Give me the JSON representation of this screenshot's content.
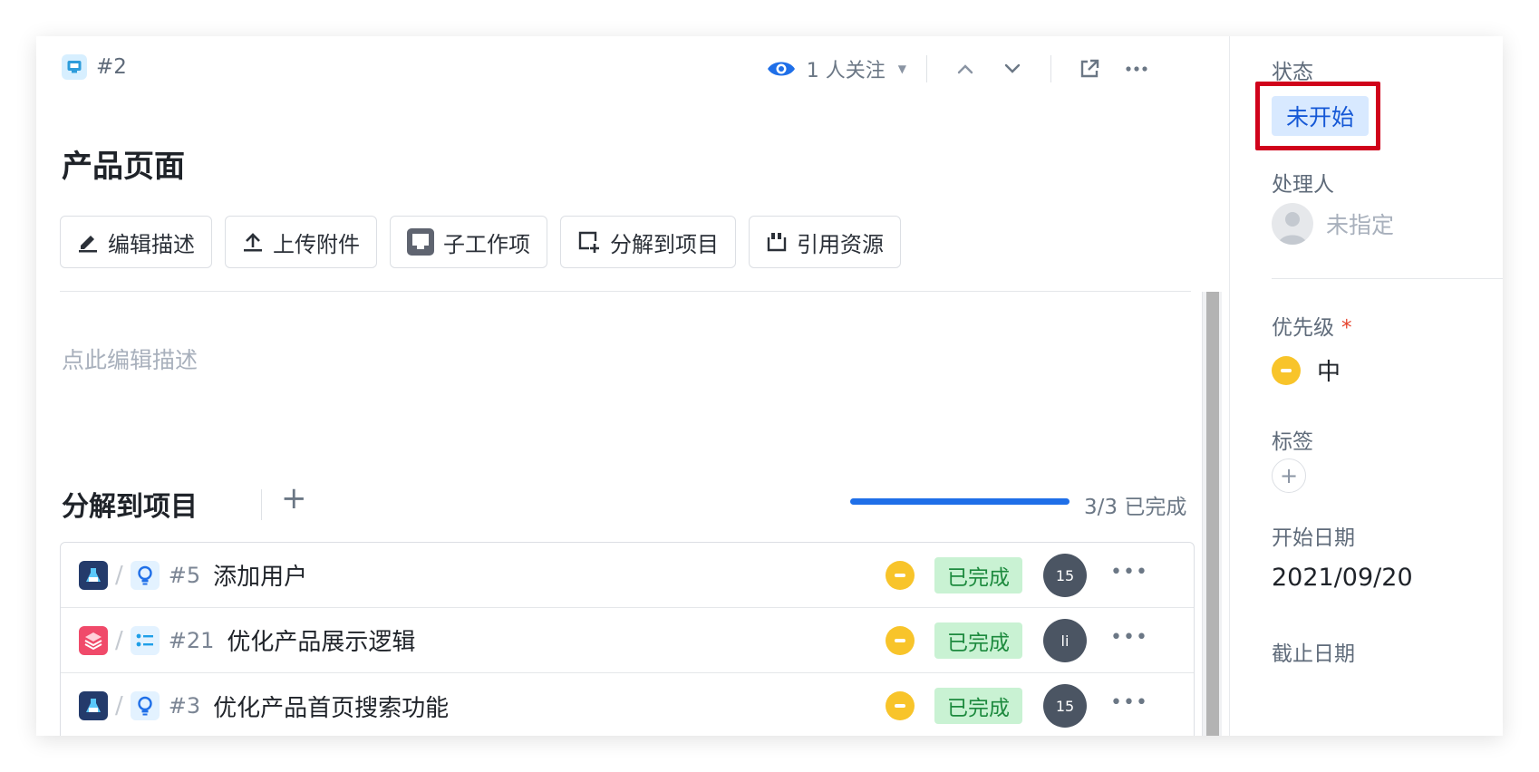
{
  "header": {
    "item_id": "#2",
    "watch_label": "1 人关注",
    "title": "产品页面"
  },
  "toolbar": {
    "edit_desc": "编辑描述",
    "upload": "上传附件",
    "sub_item": "子工作项",
    "breakdown": "分解到项目",
    "reference": "引用资源"
  },
  "description": {
    "placeholder": "点此编辑描述"
  },
  "breakdown": {
    "title": "分解到项目",
    "add_icon": "plus-icon",
    "progress_text": "3/3 已完成",
    "progress_fraction": 1.0,
    "items": [
      {
        "id": "#5",
        "title": "添加用户",
        "status": "已完成",
        "assignee": "15",
        "project_color": "#243b6b",
        "type_icon": "bulb-icon"
      },
      {
        "id": "#21",
        "title": "优化产品展示逻辑",
        "status": "已完成",
        "assignee": "li",
        "project_color": "#f04a6a",
        "type_icon": "list-icon"
      },
      {
        "id": "#3",
        "title": "优化产品首页搜索功能",
        "status": "已完成",
        "assignee": "15",
        "project_color": "#243b6b",
        "type_icon": "bulb-icon"
      }
    ]
  },
  "side": {
    "status_label": "状态",
    "status_value": "未开始",
    "assignee_label": "处理人",
    "assignee_value": "未指定",
    "priority_label": "优先级",
    "priority_required": "*",
    "priority_value": "中",
    "tags_label": "标签",
    "start_label": "开始日期",
    "start_value": "2021/09/20",
    "due_label": "截止日期"
  },
  "colors": {
    "accent": "#1f6fe8",
    "status_done_bg": "#c9f2d3",
    "status_done_text": "#1d8a3e",
    "priority_medium": "#f8c42a",
    "highlight": "#d0021b"
  }
}
